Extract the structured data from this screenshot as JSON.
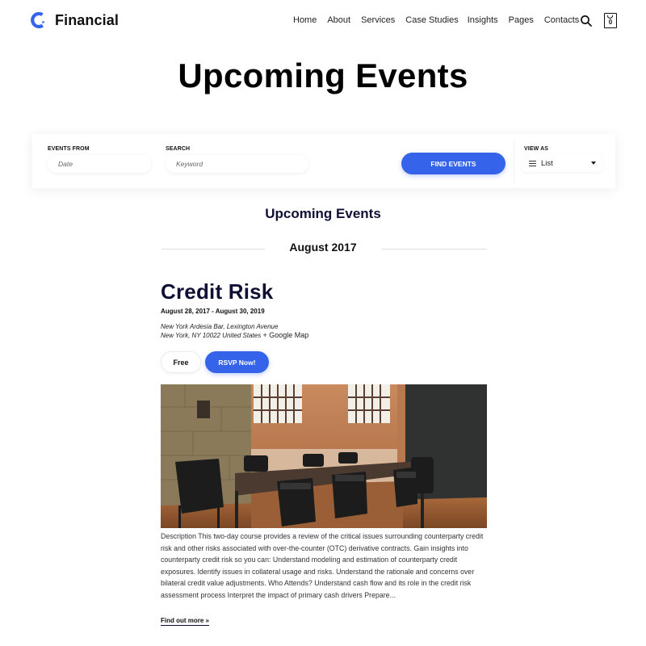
{
  "header": {
    "brand": "Financial",
    "brand_color": "#3563e9",
    "nav": [
      "Home",
      "About",
      "Services",
      "Case Studies",
      "Insights",
      "Pages",
      "Contacts"
    ],
    "search_icon": "search-icon",
    "cart_icon": "shopping-bag-icon",
    "cart_count": "0"
  },
  "page": {
    "title": "Upcoming Events"
  },
  "filter_bar": {
    "events_from_label": "EVENTS FROM",
    "events_from_placeholder": "Date",
    "search_label": "SEARCH",
    "search_placeholder": "Keyword",
    "find_button": "FIND EVENTS",
    "view_as_label": "VIEW AS",
    "view_as_value": "List",
    "view_icon": "list-icon"
  },
  "events_section": {
    "title": "Upcoming Events",
    "month": "August 2017",
    "events": [
      {
        "title": "Credit Risk",
        "dates": "August 28, 2017 - August 30, 2019",
        "venue_line1": "New York Ardesia Bar, Lexington Avenue",
        "venue_line2": "New York, NY 10022 United States",
        "map_link": "+ Google Map",
        "price": "Free",
        "rsvp": "RSVP Now!",
        "image_alt": "conference room with table and chairs",
        "description": "Description This two-day course provides a review of the critical issues surrounding counterparty credit risk and other risks associated with over-the-counter (OTC) derivative contracts. Gain insights into counterparty credit risk so you can: Understand modeling and estimation of counterparty credit exposures. Identify issues in collateral usage and risks. Understand the rationale and concerns over bilateral credit value adjustments. Who Attends? Understand cash flow and its role in the credit risk assessment process Interpret the impact of primary cash drivers Prepare...",
        "read_more": "Find out more »"
      }
    ]
  },
  "colors": {
    "accent": "#3563e9",
    "heading_dark": "#0f1033"
  }
}
